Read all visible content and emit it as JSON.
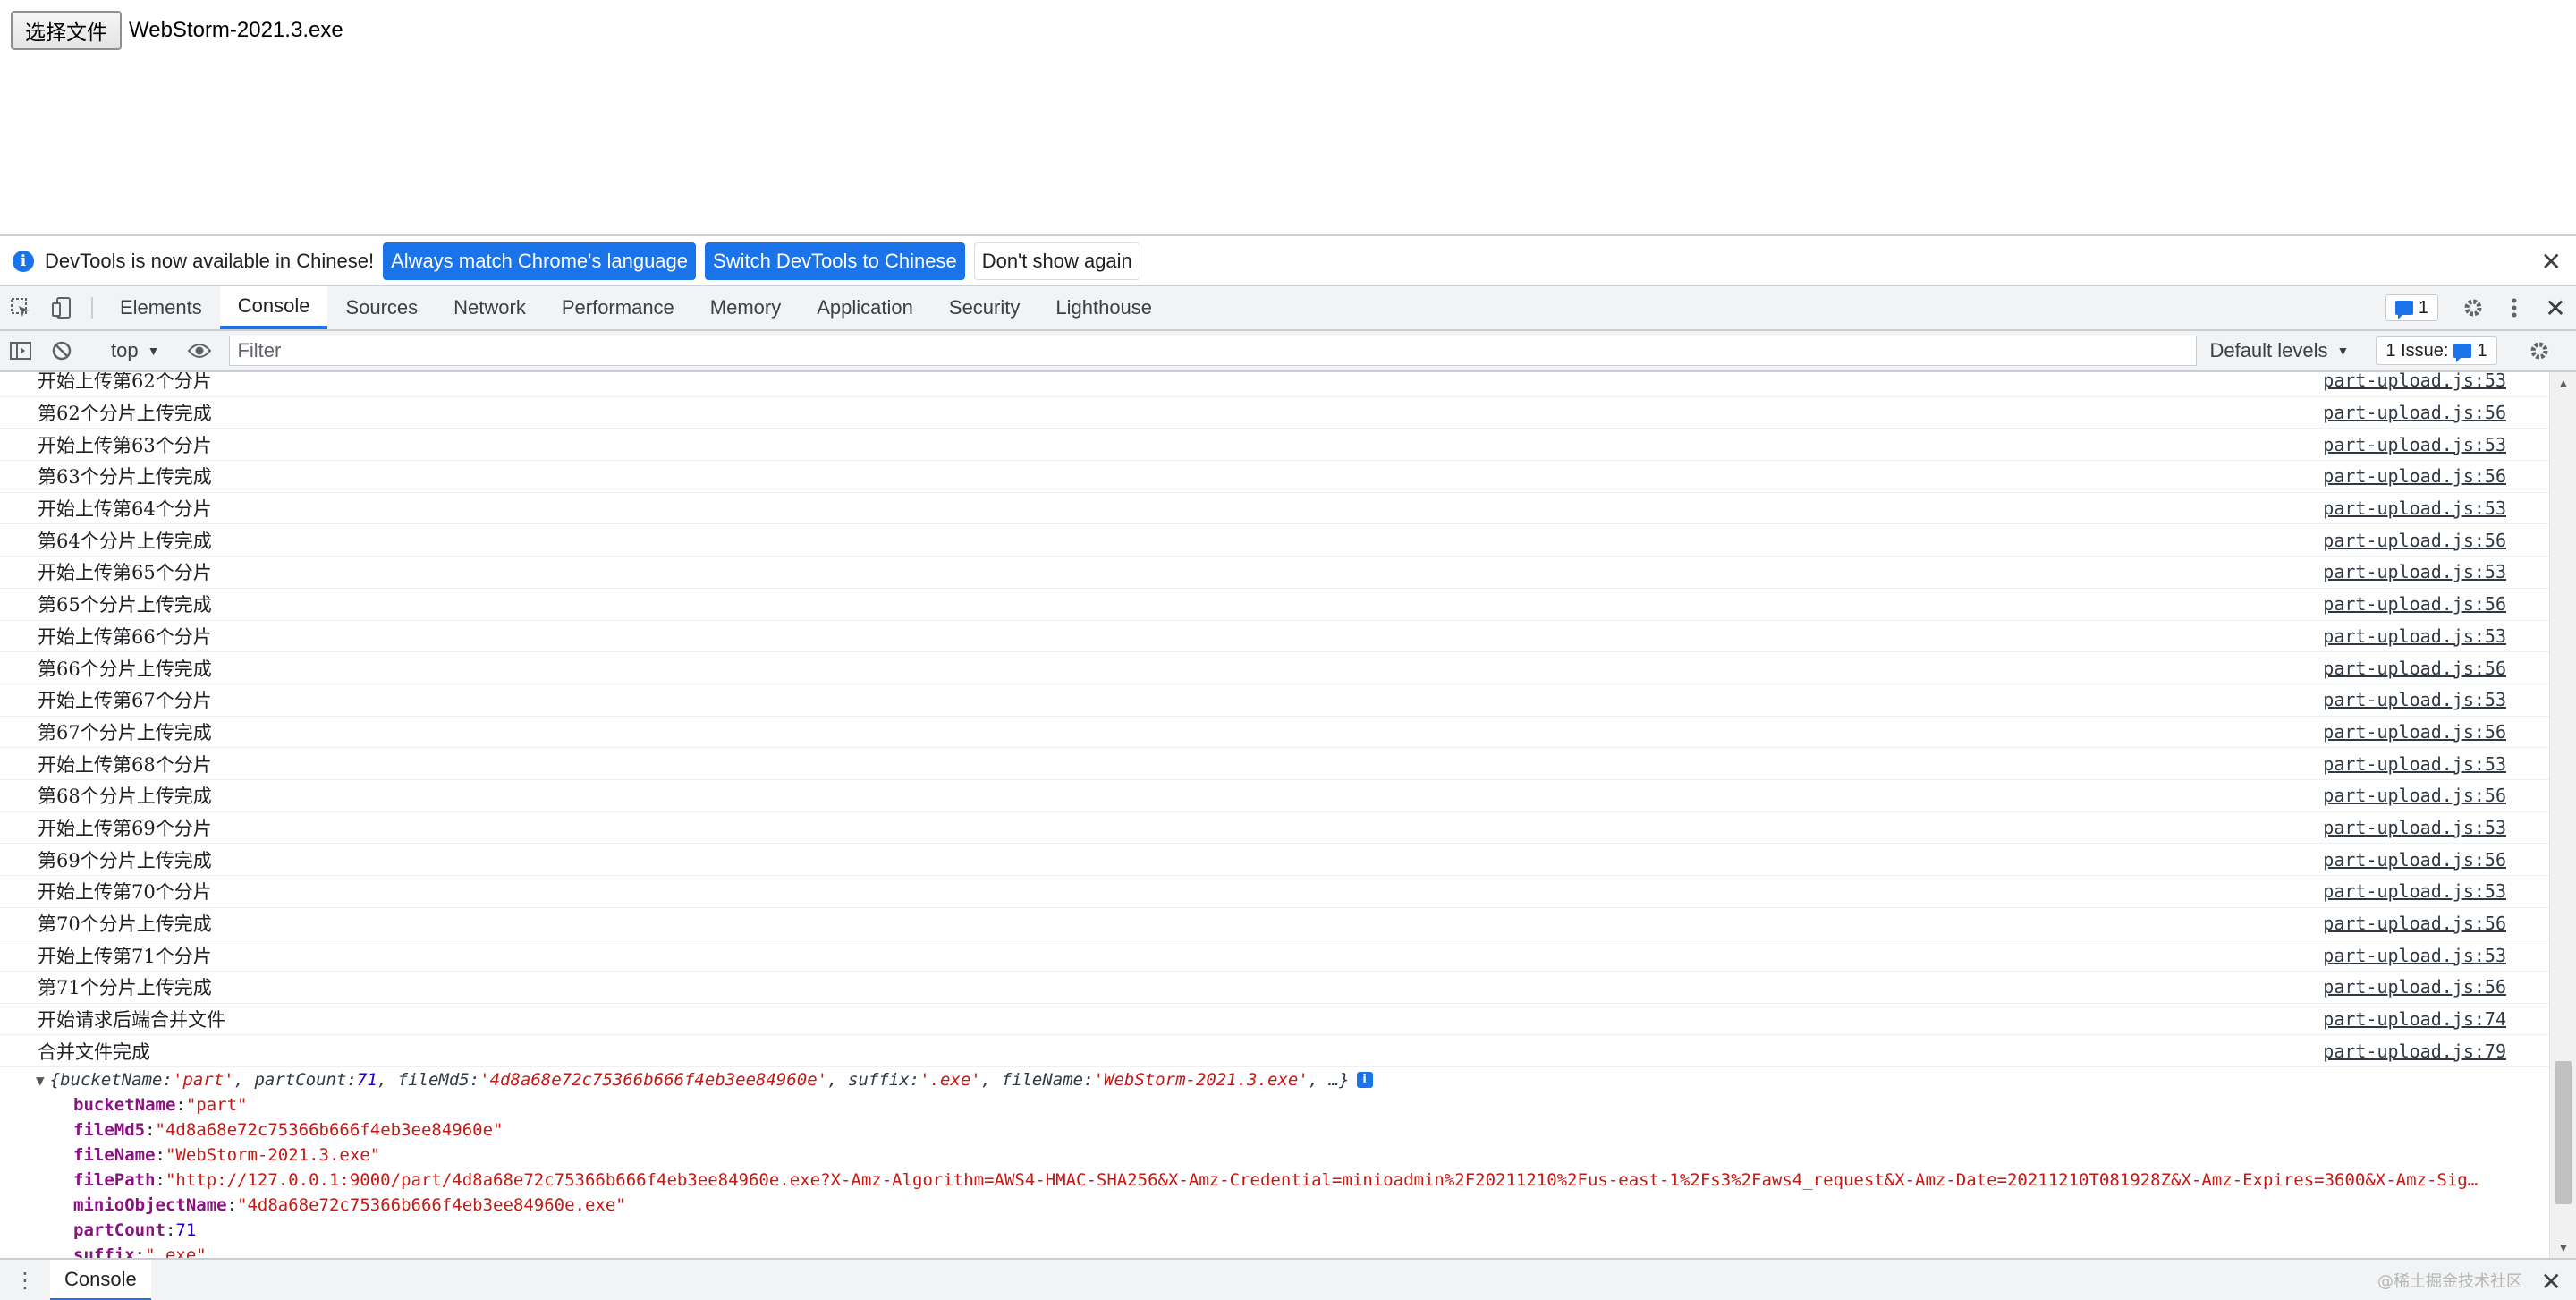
{
  "page": {
    "file_button_label": "选择文件",
    "file_name": "WebStorm-2021.3.exe"
  },
  "infobar": {
    "text": "DevTools is now available in Chinese!",
    "always_match": "Always match Chrome's language",
    "switch_chinese": "Switch DevTools to Chinese",
    "dont_show": "Don't show again"
  },
  "tabs": [
    "Elements",
    "Console",
    "Sources",
    "Network",
    "Performance",
    "Memory",
    "Application",
    "Security",
    "Lighthouse"
  ],
  "tabbar": {
    "badge_count": "1"
  },
  "toolbar": {
    "context": "top",
    "filter_placeholder": "Filter",
    "levels": "Default levels",
    "issues_label": "1 Issue:",
    "issues_count": "1"
  },
  "console_messages": [
    {
      "text": "开始上传第62个分片",
      "source": "part-upload.js:53"
    },
    {
      "text": "第62个分片上传完成",
      "source": "part-upload.js:56"
    },
    {
      "text": "开始上传第63个分片",
      "source": "part-upload.js:53"
    },
    {
      "text": "第63个分片上传完成",
      "source": "part-upload.js:56"
    },
    {
      "text": "开始上传第64个分片",
      "source": "part-upload.js:53"
    },
    {
      "text": "第64个分片上传完成",
      "source": "part-upload.js:56"
    },
    {
      "text": "开始上传第65个分片",
      "source": "part-upload.js:53"
    },
    {
      "text": "第65个分片上传完成",
      "source": "part-upload.js:56"
    },
    {
      "text": "开始上传第66个分片",
      "source": "part-upload.js:53"
    },
    {
      "text": "第66个分片上传完成",
      "source": "part-upload.js:56"
    },
    {
      "text": "开始上传第67个分片",
      "source": "part-upload.js:53"
    },
    {
      "text": "第67个分片上传完成",
      "source": "part-upload.js:56"
    },
    {
      "text": "开始上传第68个分片",
      "source": "part-upload.js:53"
    },
    {
      "text": "第68个分片上传完成",
      "source": "part-upload.js:56"
    },
    {
      "text": "开始上传第69个分片",
      "source": "part-upload.js:53"
    },
    {
      "text": "第69个分片上传完成",
      "source": "part-upload.js:56"
    },
    {
      "text": "开始上传第70个分片",
      "source": "part-upload.js:53"
    },
    {
      "text": "第70个分片上传完成",
      "source": "part-upload.js:56"
    },
    {
      "text": "开始上传第71个分片",
      "source": "part-upload.js:53"
    },
    {
      "text": "第71个分片上传完成",
      "source": "part-upload.js:56"
    },
    {
      "text": "开始请求后端合并文件",
      "source": "part-upload.js:74"
    },
    {
      "text": "合并文件完成",
      "source": "part-upload.js:79"
    }
  ],
  "object_summary": {
    "bucketName": "'part'",
    "partCount": "71",
    "fileMd5": "'4d8a68e72c75366b666f4eb3ee84960e'",
    "suffix": "'.exe'",
    "fileName": "'WebStorm-2021.3.exe'",
    "tail": ", …}"
  },
  "object_props": [
    {
      "key": "bucketName",
      "value": "\"part\"",
      "kind": "string"
    },
    {
      "key": "fileMd5",
      "value": "\"4d8a68e72c75366b666f4eb3ee84960e\"",
      "kind": "string"
    },
    {
      "key": "fileName",
      "value": "\"WebStorm-2021.3.exe\"",
      "kind": "string"
    },
    {
      "key": "filePath",
      "value": "\"http://127.0.0.1:9000/part/4d8a68e72c75366b666f4eb3ee84960e.exe?X-Amz-Algorithm=AWS4-HMAC-SHA256&X-Amz-Credential=minioadmin%2F20211210%2Fus-east-1%2Fs3%2Faws4_request&X-Amz-Date=20211210T081928Z&X-Amz-Expires=3600&X-Amz-Sig…",
      "kind": "string"
    },
    {
      "key": "minioObjectName",
      "value": "\"4d8a68e72c75366b666f4eb3ee84960e.exe\"",
      "kind": "string"
    },
    {
      "key": "partCount",
      "value": "71",
      "kind": "number"
    },
    {
      "key": "suffix",
      "value": "\".exe\"",
      "kind": "string"
    }
  ],
  "drawer": {
    "tab": "Console",
    "watermark": "@稀土掘金技术社区"
  }
}
